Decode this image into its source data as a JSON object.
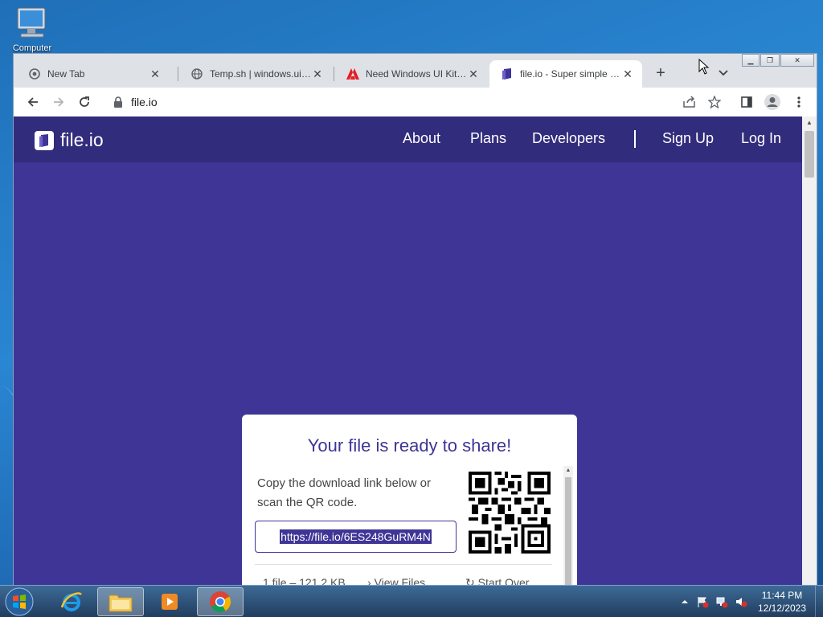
{
  "desktop": {
    "icon_label": "Computer"
  },
  "browser": {
    "tabs": [
      {
        "title": "New Tab",
        "icon": "chrome-icon"
      },
      {
        "title": "Temp.sh | windows.ui.zip",
        "icon": "globe-icon"
      },
      {
        "title": "Need Windows UI Kit file",
        "icon": "adobe-icon"
      },
      {
        "title": "file.io - Super simple file sharing",
        "icon": "fileio-icon"
      }
    ],
    "new_tab_label": "+",
    "address": "file.io"
  },
  "site": {
    "logo_text": "file.io",
    "nav": {
      "about": "About",
      "plans": "Plans",
      "developers": "Developers",
      "divider": "|",
      "sign_up": "Sign Up",
      "log_in": "Log In"
    },
    "card": {
      "heading": "Your file is ready to share!",
      "description": "Copy the download link below or scan the QR code.",
      "link": "https://file.io/6ES248GuRM4N",
      "footer": {
        "file_info": "1 file – 121.2 KB",
        "view_files": "View Files",
        "start_over": "Start Over"
      }
    },
    "colors": {
      "brand_purple": "#3e3596",
      "nav_purple": "#322c7c"
    }
  },
  "taskbar": {
    "apps": [
      "internet-explorer",
      "file-explorer",
      "media-player",
      "chrome"
    ],
    "clock_time": "11:44 PM",
    "clock_date": "12/12/2023"
  }
}
